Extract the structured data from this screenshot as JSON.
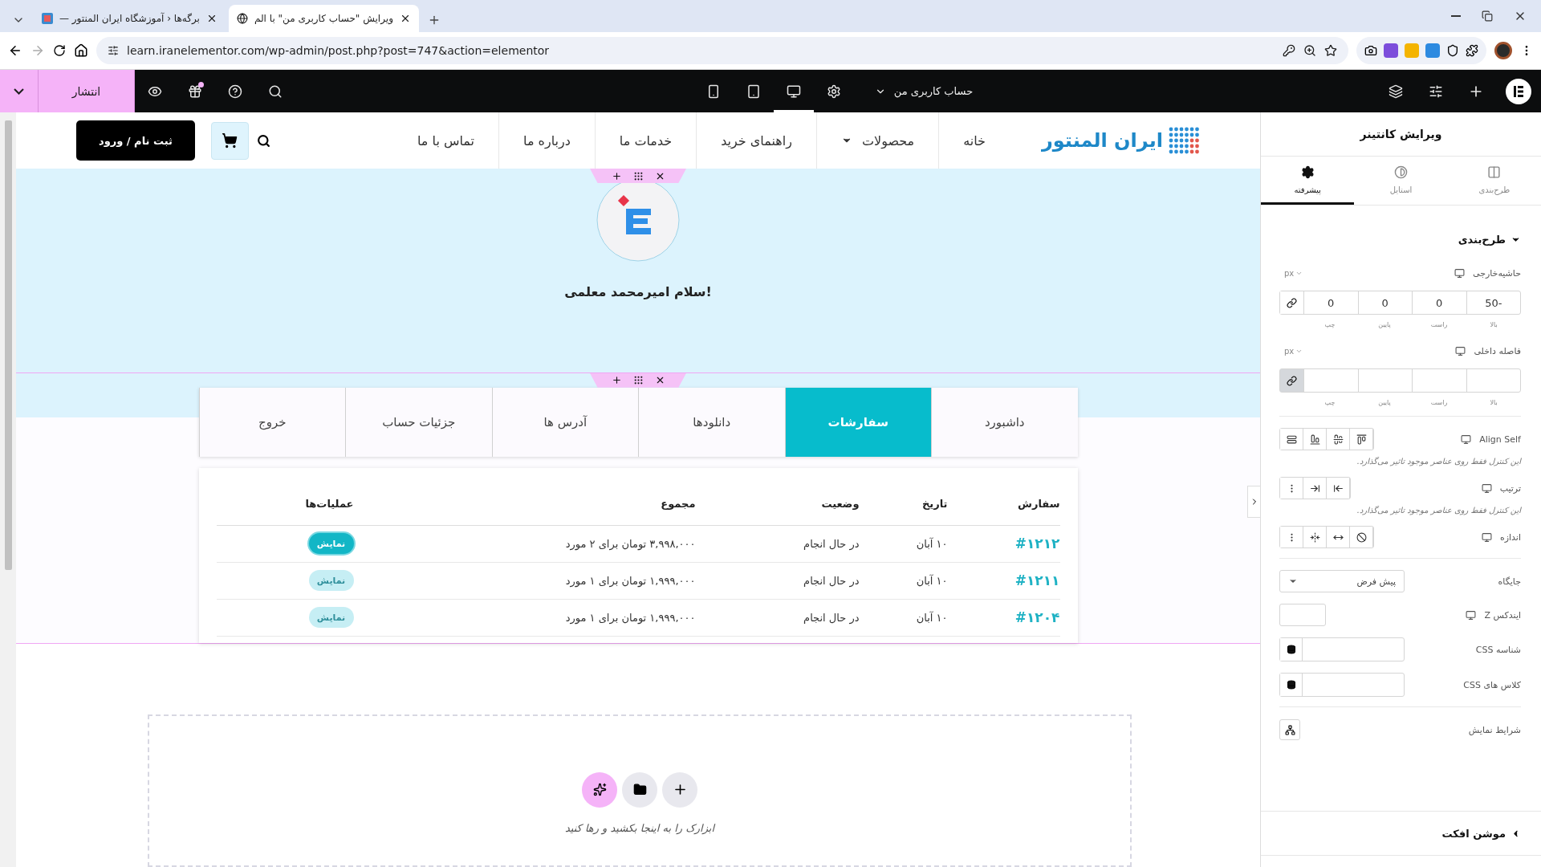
{
  "browser": {
    "background_tab": {
      "title": "برگه‌ها ‹ آموزشگاه ایران المنتور —"
    },
    "current_tab": {
      "title": "ویرایش \"حساب کاربری من\" با الم"
    },
    "url": "learn.iranelementor.com/wp-admin/post.php?post=747&action=elementor"
  },
  "editor_bar": {
    "publish": "انتشار",
    "devices": [
      {
        "kind": "mobile",
        "selected": false
      },
      {
        "kind": "tablet",
        "selected": false
      },
      {
        "kind": "desktop",
        "selected": true
      }
    ],
    "page_title": "حساب کاربری من"
  },
  "site_header": {
    "logo": "ایران المنتور",
    "nav": [
      {
        "label": "خانه",
        "has_dropdown": false
      },
      {
        "label": "محصولات",
        "has_dropdown": true
      },
      {
        "label": "راهنمای خرید",
        "has_dropdown": false
      },
      {
        "label": "خدمات ما",
        "has_dropdown": false
      },
      {
        "label": "درباره ما",
        "has_dropdown": false
      },
      {
        "label": "تماس با ما",
        "has_dropdown": false
      }
    ],
    "login": "ثبت نام / ورود"
  },
  "greeting": "سلام امیرمحمد معلمی!",
  "account_tabs": [
    {
      "label": "داشبورد",
      "selected": false
    },
    {
      "label": "سفارشات",
      "selected": true
    },
    {
      "label": "دانلودها",
      "selected": false
    },
    {
      "label": "آدرس ها",
      "selected": false
    },
    {
      "label": "جزئیات حساب",
      "selected": false
    },
    {
      "label": "خروج",
      "selected": false
    }
  ],
  "orders": {
    "columns": [
      "سفارش",
      "تاریخ",
      "وضعیت",
      "مجموع",
      "عملیات‌ها"
    ],
    "rows": [
      {
        "order": "#۱۲۱۲",
        "date": "۱۰ آبان",
        "status": "در حال انجام",
        "total": "۳,۹۹۸,۰۰۰ تومان برای ۲ مورد",
        "action": "نمایش",
        "highlighted": true
      },
      {
        "order": "#۱۲۱۱",
        "date": "۱۰ آبان",
        "status": "در حال انجام",
        "total": "۱,۹۹۹,۰۰۰ تومان برای ۱ مورد",
        "action": "نمایش",
        "highlighted": false
      },
      {
        "order": "#۱۲۰۴",
        "date": "۱۰ آبان",
        "status": "در حال انجام",
        "total": "۱,۹۹۹,۰۰۰ تومان برای ۱ مورد",
        "action": "نمایش",
        "highlighted": false
      }
    ]
  },
  "drop_zone": {
    "hint": "ابزارک را به اینجا بکشید و رها کنید"
  },
  "panel": {
    "title": "ویرایش کانتینر",
    "tabs": [
      {
        "label": "طرح‌بندی",
        "kind": "layout",
        "selected": false
      },
      {
        "label": "استایل",
        "kind": "style",
        "selected": false
      },
      {
        "label": "پیشرفته",
        "kind": "advanced",
        "selected": true
      }
    ],
    "sections": [
      {
        "title": "طرح‌بندی",
        "expanded": true,
        "controls": [
          {
            "kind": "dimensions",
            "label": "حاشیه‌خارجی",
            "responsive": true,
            "unit": "px",
            "linked": false,
            "values": [
              {
                "side": "بالا",
                "value": "50-"
              },
              {
                "side": "راست",
                "value": "0"
              },
              {
                "side": "پایین",
                "value": "0"
              },
              {
                "side": "چپ",
                "value": "0"
              }
            ]
          },
          {
            "kind": "dimensions",
            "label": "فاصله داخلی",
            "responsive": true,
            "unit": "px",
            "linked": true,
            "divider_after": true,
            "values": [
              {
                "side": "بالا"
              },
              {
                "side": "راست"
              },
              {
                "side": "پایین"
              },
              {
                "side": "چپ"
              }
            ]
          },
          {
            "kind": "align-self",
            "label": "Align Self",
            "responsive": true,
            "hint": "این کنترل فقط روی عناصر موجود تاثیر می‌گذارد."
          },
          {
            "kind": "order",
            "label": "ترتیب",
            "responsive": true,
            "hint": "این کنترل فقط روی عناصر موجود تاثیر می‌گذارد."
          },
          {
            "kind": "size",
            "label": "اندازه",
            "responsive": true,
            "divider_after": true
          },
          {
            "kind": "select",
            "label": "جایگاه",
            "value": "پیش فرض"
          },
          {
            "kind": "number",
            "label": "ایندکس Z",
            "responsive": true
          },
          {
            "kind": "dynamic-text",
            "label": "شناسه CSS"
          },
          {
            "kind": "dynamic-text",
            "label": "کلاس های CSS",
            "divider_after": true
          },
          {
            "kind": "conditions",
            "label": "شرایط نمایش"
          }
        ]
      },
      {
        "title": "موشن افکت",
        "expanded": false
      }
    ]
  }
}
